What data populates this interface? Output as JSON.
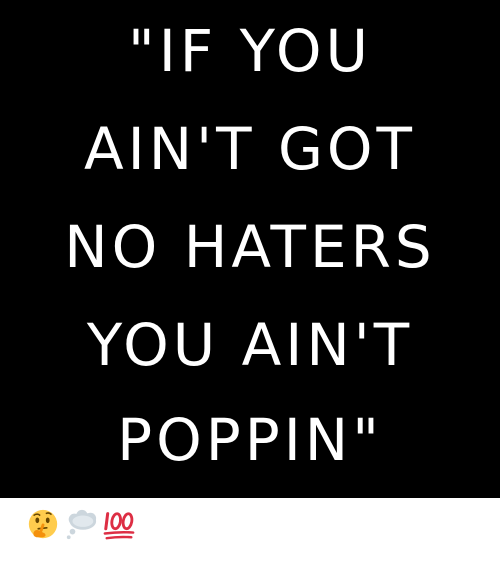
{
  "quote": {
    "lines": [
      "\"IF YOU",
      "AIN'T GOT",
      "NO HATERS",
      "YOU AIN'T",
      "POPPIN\""
    ]
  },
  "caption": {
    "emojis": [
      "thinking-face-icon",
      "thought-balloon-icon",
      "hundred-points-icon"
    ]
  },
  "colors": {
    "background": "#000000",
    "text": "#ffffff",
    "strip": "#ffffff"
  }
}
